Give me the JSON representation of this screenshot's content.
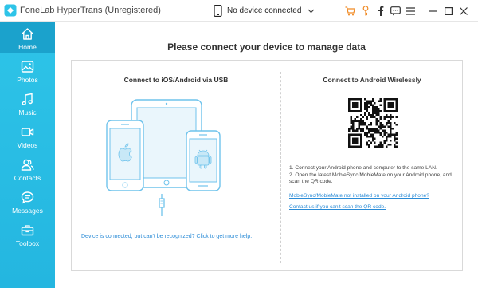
{
  "app": {
    "title": "FoneLab HyperTrans (Unregistered)"
  },
  "device_selector": {
    "value": "No device connected"
  },
  "toolbar_icons": [
    "cart-icon",
    "key-icon",
    "facebook-icon",
    "feedback-icon",
    "menu-icon",
    "minimize-icon",
    "maximize-icon",
    "close-icon"
  ],
  "colors": {
    "sidebar": "#2ec4e8",
    "sidebar_active": "#1ba2cc",
    "accent_orange": "#f08a24",
    "link": "#2a8bd6",
    "device_outline": "#6fc3ec"
  },
  "sidebar": {
    "items": [
      {
        "label": "Home",
        "icon": "home-icon",
        "active": true
      },
      {
        "label": "Photos",
        "icon": "photos-icon",
        "active": false
      },
      {
        "label": "Music",
        "icon": "music-icon",
        "active": false
      },
      {
        "label": "Videos",
        "icon": "videos-icon",
        "active": false
      },
      {
        "label": "Contacts",
        "icon": "contacts-icon",
        "active": false
      },
      {
        "label": "Messages",
        "icon": "messages-icon",
        "active": false
      },
      {
        "label": "Toolbox",
        "icon": "toolbox-icon",
        "active": false
      }
    ]
  },
  "main": {
    "title": "Please connect your device to manage data",
    "usb": {
      "title": "Connect to iOS/Android via USB",
      "help_link": "Device is connected, but can't be recognized? Click to get more help."
    },
    "wireless": {
      "title": "Connect to Android Wirelessly",
      "step1": "1. Connect your Android phone and computer to the same LAN.",
      "step2": "2. Open the latest MobieSync/MobieMate on your Android phone, and scan the QR code.",
      "link_not_installed": "MobieSync/MobieMate not installed on your Android phone?",
      "link_cant_scan": "Contact us if you can't scan the QR code."
    }
  }
}
